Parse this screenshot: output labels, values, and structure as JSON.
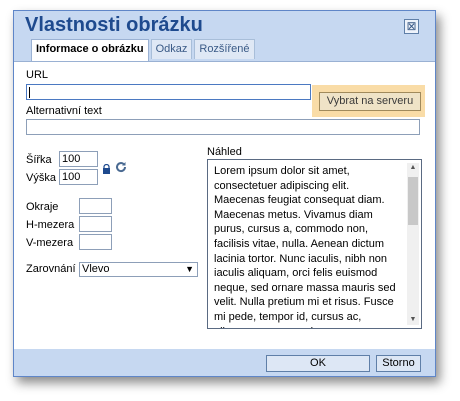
{
  "dialog": {
    "title": "Vlastnosti obrázku",
    "close_glyph": "⊠",
    "tabs": [
      {
        "label": "Informace o obrázku",
        "active": true
      },
      {
        "label": "Odkaz",
        "active": false
      },
      {
        "label": "Rozšířené",
        "active": false
      }
    ]
  },
  "form": {
    "url_label": "URL",
    "url_value": "",
    "browse_label": "Vybrat na serveru",
    "alt_label": "Alternativní text",
    "alt_value": "",
    "width_label": "Šířka",
    "width_value": "100",
    "height_label": "Výška",
    "height_value": "100",
    "border_label": "Okraje",
    "border_value": "",
    "hspace_label": "H-mezera",
    "hspace_value": "",
    "vspace_label": "V-mezera",
    "vspace_value": "",
    "align_label": "Zarovnání",
    "align_value": "Vlevo",
    "lock_icon": "lock-icon",
    "reset_icon": "reset-size-icon"
  },
  "preview": {
    "label": "Náhled",
    "text": "Lorem ipsum dolor sit amet, consectetuer adipiscing elit. Maecenas feugiat consequat diam. Maecenas metus. Vivamus diam purus, cursus a, commodo non, facilisis vitae, nulla. Aenean dictum lacinia tortor. Nunc iaculis, nibh non iaculis aliquam, orci felis euismod neque, sed ornare massa mauris sed velit. Nulla pretium mi et risus. Fusce mi pede, tempor id, cursus ac, ullamcorper nec, enim."
  },
  "footer": {
    "ok_label": "OK",
    "cancel_label": "Storno"
  },
  "colors": {
    "title": "#1e4a8e",
    "header_bg": "#c6d8f1",
    "browse_highlight": "#f7d08a"
  }
}
